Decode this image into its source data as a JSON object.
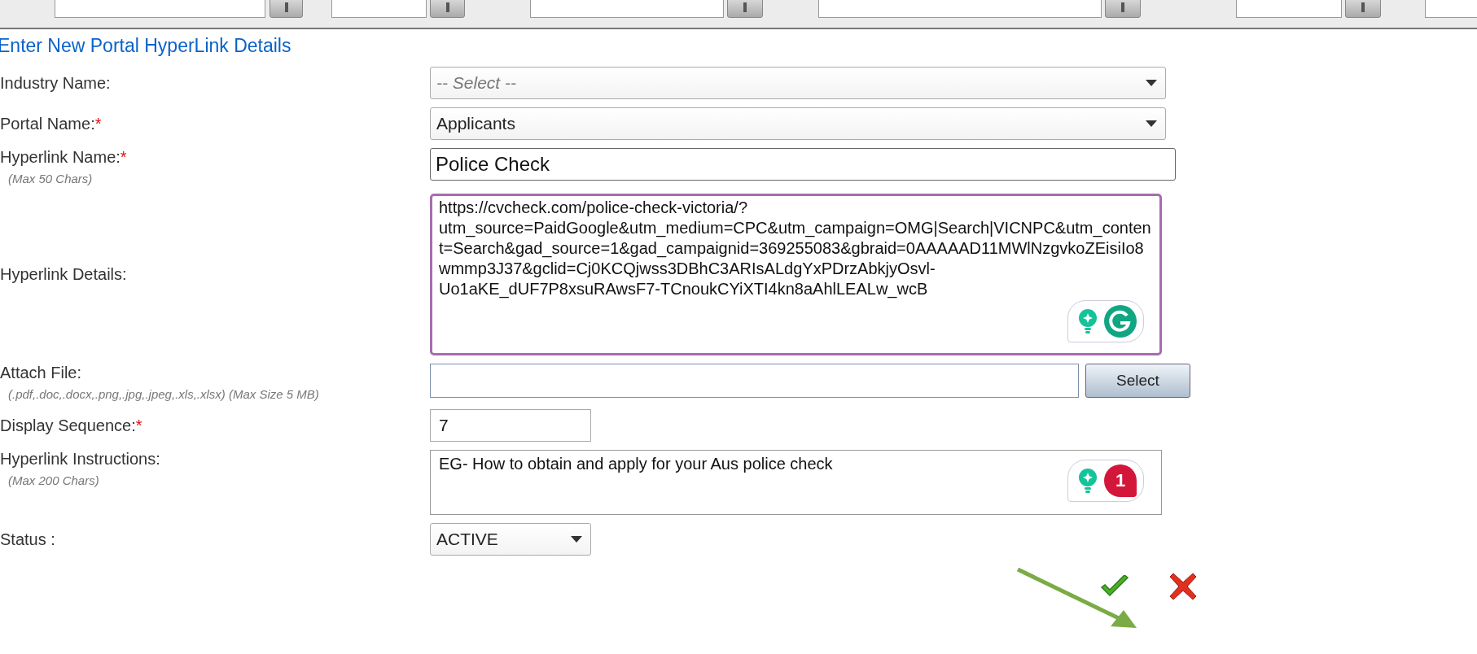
{
  "heading": "Enter New Portal HyperLink Details",
  "fields": [
    {
      "kind": "select",
      "label": "Industry Name:",
      "placeholder": "-- Select --"
    },
    {
      "kind": "select",
      "label": "Portal Name:",
      "required_mark": "*",
      "value": "Applicants"
    },
    {
      "kind": "text",
      "label": "Hyperlink Name:",
      "required_mark": "*",
      "hint": "(Max 50 Chars)",
      "value": "Police Check"
    },
    {
      "kind": "textarea",
      "label": "Hyperlink Details:",
      "focused": true,
      "value": "https://cvcheck.com/police-check-victoria/?utm_source=PaidGoogle&utm_medium=CPC&utm_campaign=OMG|Search|VICNPC&utm_content=Search&gad_source=1&gad_campaignid=369255083&gbraid=0AAAAAD11MWlNzgvkoZEisiIo8wmmp3J37&gclid=Cj0KCQjwss3DBhC3ARIsALdgYxPDrzAbkjyOsvl-Uo1aKE_dUF7P8xsuRAwsF7-TCnoukCYiXTI4kn8aAhlLEALw_wcB"
    },
    {
      "kind": "file",
      "label": "Attach File:",
      "hint": "(.pdf,.doc,.docx,.png,.jpg,.jpeg,.xls,.xlsx) (Max Size 5 MB)",
      "button": "Select"
    },
    {
      "kind": "number",
      "label": "Display Sequence:",
      "required_mark": "*",
      "value": "7"
    },
    {
      "kind": "textarea",
      "label": "Hyperlink Instructions:",
      "hint": "(Max 200 Chars)",
      "focused": false,
      "value": "EG- How to obtain and apply for your Aus police check",
      "assistant_badge": "1"
    },
    {
      "kind": "status",
      "label": "Status :",
      "value": "ACTIVE"
    }
  ],
  "actions": [
    {
      "kind": "save"
    },
    {
      "kind": "cancel"
    }
  ]
}
